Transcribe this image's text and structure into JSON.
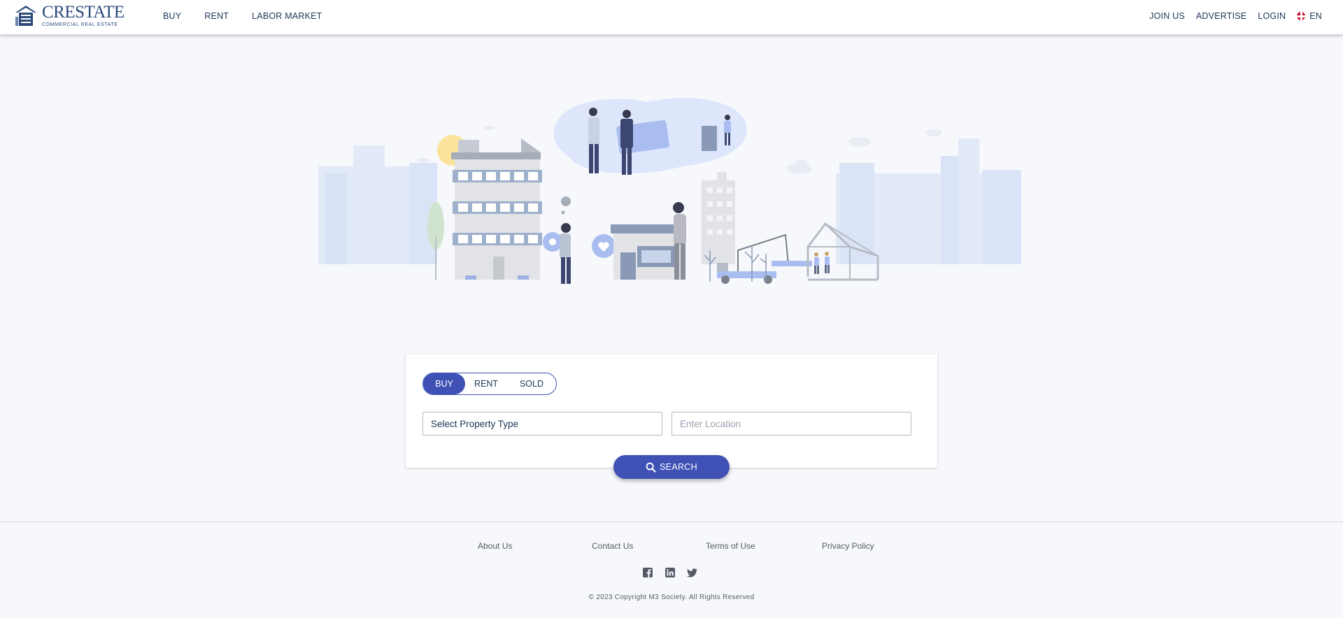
{
  "brand": {
    "name": "CRESTATE",
    "tagline": "COMMERCIAL REAL ESTATE"
  },
  "nav_left": [
    "BUY",
    "RENT",
    "LABOR MARKET"
  ],
  "nav_right": {
    "join": "JOIN US",
    "advertise": "ADVERTISE",
    "login": "LOGIN",
    "lang": "EN"
  },
  "search": {
    "tabs": [
      "BUY",
      "RENT",
      "SOLD"
    ],
    "active_tab": "BUY",
    "property_type": "Select Property Type",
    "location_placeholder": "Enter Location",
    "button": "SEARCH"
  },
  "footer": {
    "links": [
      "About Us",
      "Contact Us",
      "Terms of Use",
      "Privacy Policy"
    ],
    "social": [
      "facebook-icon",
      "linkedin-icon",
      "twitter-icon"
    ],
    "copyright": "© 2023 Copyright M3 Society. All Rights Reserved"
  },
  "colors": {
    "primary": "#3f51b5",
    "nav_text": "#1d3557",
    "background": "#f7f8fc"
  }
}
